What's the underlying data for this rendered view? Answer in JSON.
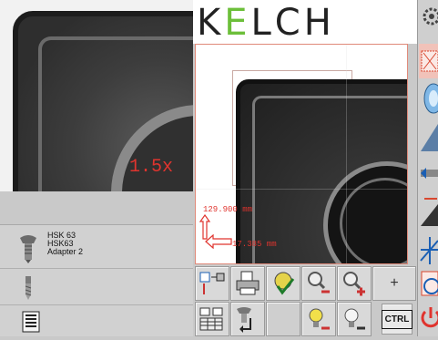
{
  "header": {
    "logo_text": "KELCH",
    "logo_accent_letter": "E"
  },
  "left_view": {
    "zoom_label": "1.5x"
  },
  "right_view": {
    "measure_y": "129.900 mm",
    "measure_x": "17.385 mm"
  },
  "tool": {
    "line1": "HSK 63",
    "line2": "HSK63",
    "line3": "Adapter 2"
  },
  "toolbar": {
    "plus_label": "+",
    "ctrl_label": "CTRL"
  },
  "colors": {
    "accent_green": "#6cbf3a",
    "measure_red": "#e0342e",
    "background": "#c9c9c9"
  },
  "icons": [
    "spindle-icon",
    "drill-icon",
    "list-icon",
    "camera-select-icon",
    "printer-icon",
    "check-icon",
    "zoom-out-icon",
    "zoom-in-icon",
    "light-down-icon",
    "light-up-icon",
    "power-icon",
    "settings-icon",
    "crosshair-icon",
    "lens-icon"
  ]
}
